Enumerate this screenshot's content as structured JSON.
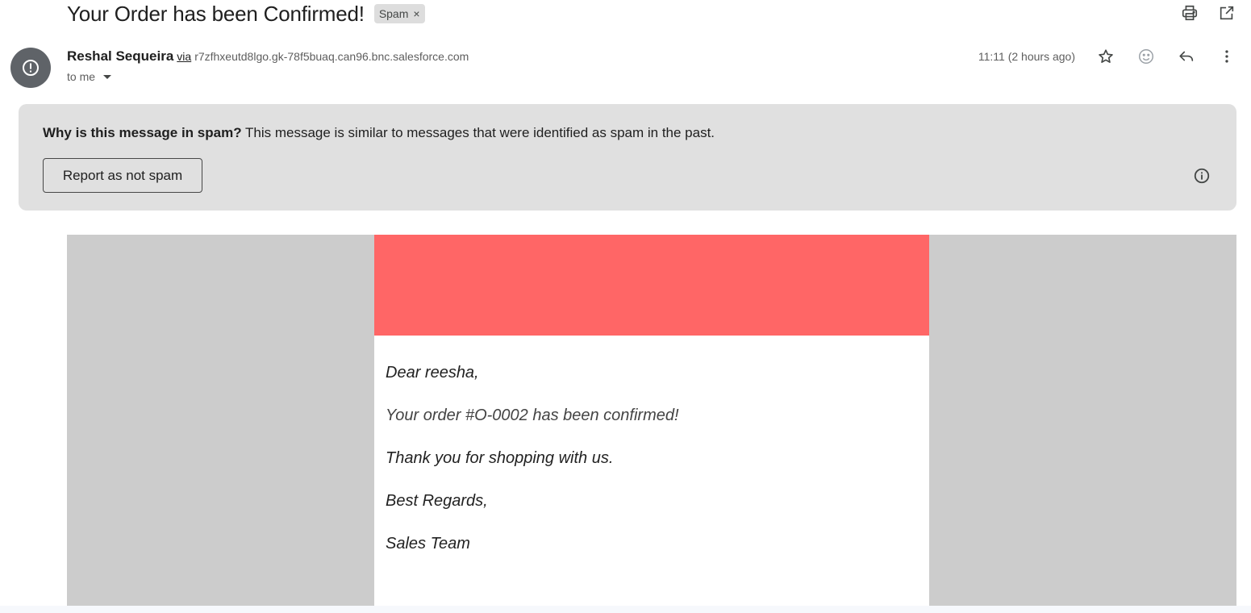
{
  "subject": {
    "title": "Your Order has been Confirmed!",
    "label": "Spam",
    "label_remove": "×"
  },
  "sender": {
    "name": "Reshal Sequeira",
    "via": "via",
    "address": "r7zfhxeutd8lgo.gk-78f5buaq.can96.bnc.salesforce.com",
    "to": "to me",
    "time": "11:11 (2 hours ago)"
  },
  "banner": {
    "question": "Why is this message in spam?",
    "explanation": " This message is similar to messages that were identified as spam in the past.",
    "button": "Report as not spam"
  },
  "email": {
    "header_color": "#ff6666",
    "lines": [
      "Dear reesha,",
      "Your order #O-0002 has been confirmed!",
      "Thank you for shopping with us.",
      "Best Regards,",
      "Sales Team"
    ]
  },
  "icons": [
    "print-icon",
    "open-in-new-window-icon",
    "star-icon",
    "emoji-icon",
    "reply-icon",
    "more-vert-icon",
    "alert-icon",
    "info-icon"
  ]
}
